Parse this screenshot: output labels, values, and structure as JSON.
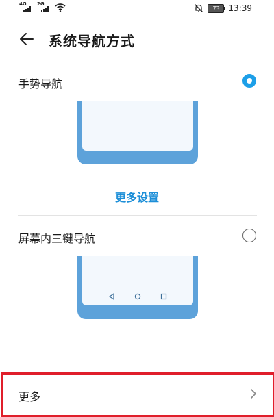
{
  "status_bar": {
    "signal1_tag": "4G",
    "signal2_tag": "2G",
    "battery": "73",
    "time": "13:39"
  },
  "header": {
    "title": "系统导航方式"
  },
  "options": [
    {
      "label": "手势导航",
      "selected": true
    },
    {
      "label": "屏幕内三键导航",
      "selected": false
    }
  ],
  "more_settings_link": "更多设置",
  "more_row": {
    "label": "更多"
  },
  "colors": {
    "accent": "#1d9fe8",
    "link": "#1d8fd8",
    "phone_frame": "#5da2da",
    "highlight_border": "#e01e2b"
  }
}
